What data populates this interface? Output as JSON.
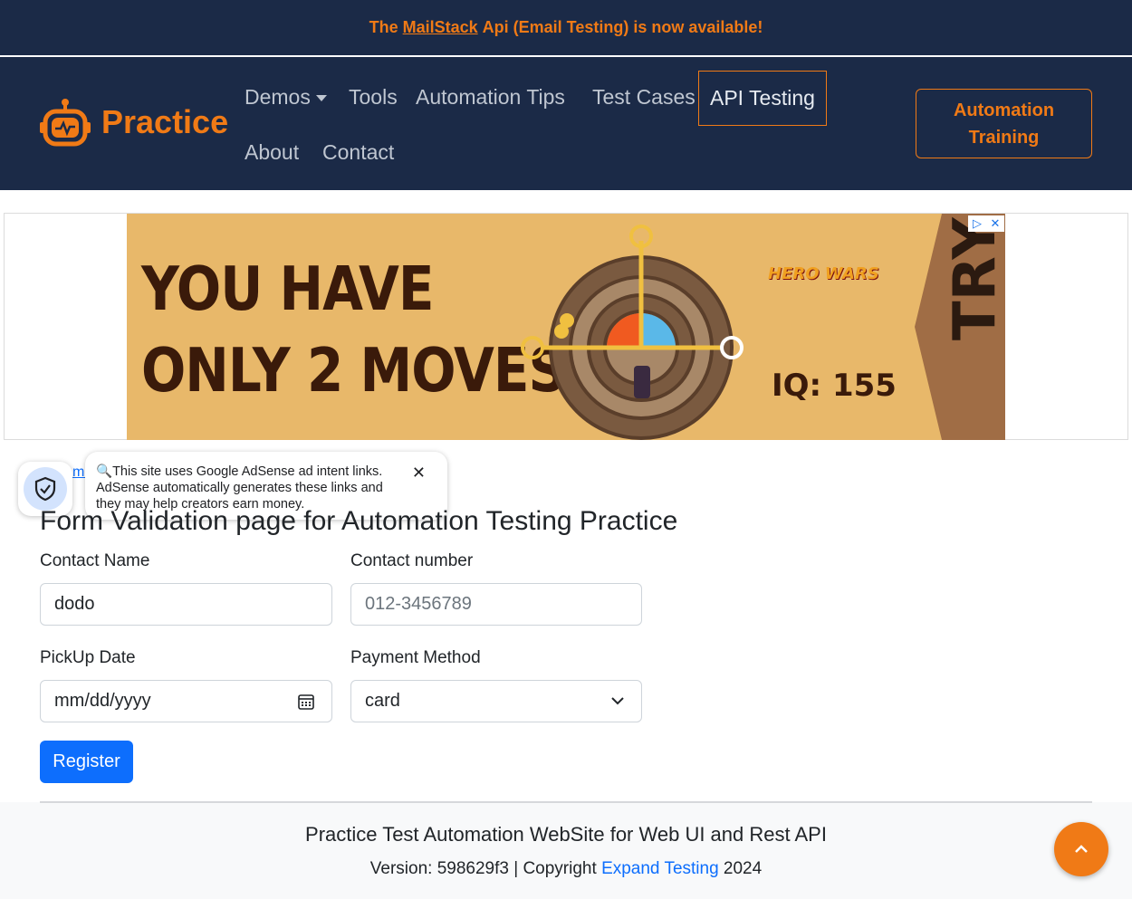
{
  "announcement": {
    "prefix": "The",
    "link": "MailStack",
    "suffix": "Api (Email Testing) is now available!"
  },
  "nav": {
    "brand": "Practice",
    "demos": "Demos",
    "tools": "Tools",
    "automation_tips": "Automation Tips",
    "test_cases": "Test Cases",
    "api_testing": "API Testing",
    "about": "About",
    "contact": "Contact",
    "training_line1": "Automation",
    "training_line2": "Training"
  },
  "ad": {
    "line1": "YOU HAVE",
    "line2": "ONLY 2 MOVES",
    "iq": "IQ: 155",
    "brand": "HERO WARS",
    "cta": "TRY"
  },
  "notice": {
    "text": "This site uses Google AdSense ad intent links. AdSense automatically generates these links and they may help creators earn money."
  },
  "breadcrumb": {
    "home": "me"
  },
  "form": {
    "title": "Form Validation page for Automation Testing Practice",
    "contact_name_label": "Contact Name",
    "contact_name_value": "dodo",
    "contact_number_label": "Contact number",
    "contact_number_placeholder": "012-3456789",
    "pickup_date_label": "PickUp Date",
    "pickup_date_placeholder": "mm/dd/yyyy",
    "payment_method_label": "Payment Method",
    "payment_method_value": "card",
    "register": "Register"
  },
  "footer": {
    "title": "Practice Test Automation WebSite for Web UI and Rest API",
    "version_prefix": "Version: 598629f3 | Copyright",
    "link": "Expand Testing",
    "year": "2024"
  },
  "colors": {
    "navy": "#1b2a47",
    "accent": "#f07a16",
    "primary": "#0d6efd"
  }
}
